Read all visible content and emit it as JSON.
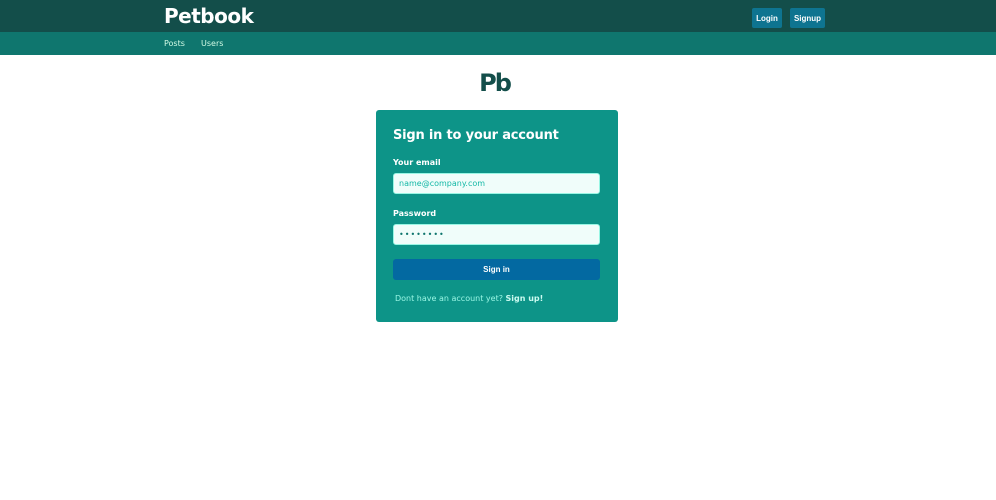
{
  "header": {
    "brand_text": "Petbook",
    "login_label": "Login",
    "signup_label": "Signup"
  },
  "nav": {
    "posts_label": "Posts",
    "users_label": "Users"
  },
  "logo": {
    "text": "Pb"
  },
  "form": {
    "title": "Sign in to your account",
    "email_label": "Your email",
    "email_placeholder": "name@company.com",
    "password_label": "Password",
    "password_value": "••••••••",
    "submit_label": "Sign in",
    "prompt_text": "Dont have an account yet?",
    "signup_link": "Sign up!"
  },
  "colors": {
    "topbar": "#134e4a",
    "subnav": "#0f766e",
    "card": "#0d9488",
    "primary_button": "#0369a1",
    "header_button": "#0e7490"
  }
}
